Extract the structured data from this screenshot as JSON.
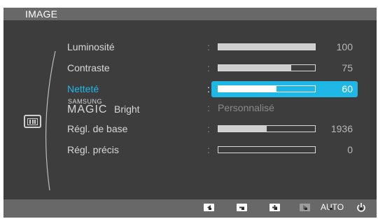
{
  "window": {
    "title": "IMAGE"
  },
  "category_icon": "monitor-image-icon",
  "menu": {
    "items": [
      {
        "label": "Luminosité",
        "value": "100",
        "level": 1.0
      },
      {
        "label": "Contraste",
        "value": "75",
        "level": 0.75
      },
      {
        "label": "Netteté",
        "value": "60",
        "level": 0.6,
        "selected": true
      },
      {
        "brand": "SAMSUNG",
        "magic": "MAGIC",
        "label": "Bright",
        "value": "Personnalisé"
      },
      {
        "label": "Régl. de base",
        "value": "1936",
        "level": 0.5
      },
      {
        "label": "Régl. précis",
        "value": "0",
        "level": 0.0
      }
    ],
    "separator": ":"
  },
  "bottom": {
    "buttons": [
      "left-arrow-icon",
      "minus-icon",
      "plus-icon",
      "enter-icon"
    ],
    "auto_label": "AUTO",
    "power_icon": "power-icon"
  },
  "colors": {
    "accent": "#1fb7e6",
    "panel": "#3d3d3d",
    "bar": "#686868"
  }
}
